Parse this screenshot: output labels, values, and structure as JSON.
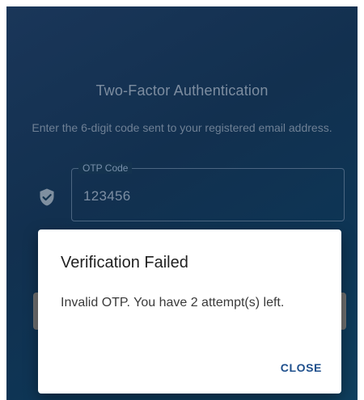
{
  "screen": {
    "title": "Two-Factor Authentication",
    "subtitle": "Enter the 6-digit code sent to your registered email address.",
    "otp_field": {
      "label": "OTP Code",
      "value": "123456",
      "icon": "shield-check-icon"
    }
  },
  "dialog": {
    "title": "Verification Failed",
    "message": "Invalid OTP. You have 2 attempt(s) left.",
    "close_label": "CLOSE"
  },
  "colors": {
    "background_start": "#1a3659",
    "background_end": "#0f3f5e",
    "accent": "#1e4f8c",
    "dialog_bg": "#ffffff"
  }
}
